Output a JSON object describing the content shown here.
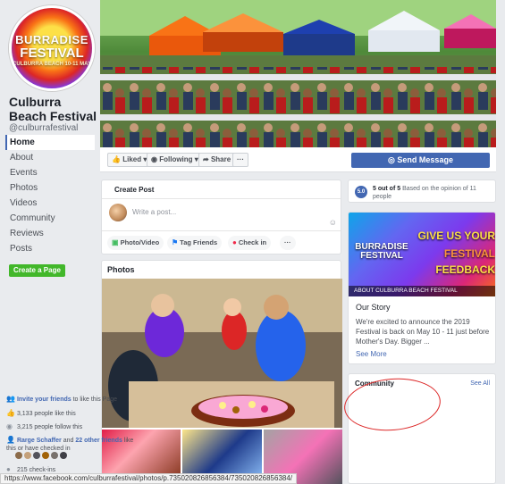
{
  "page": {
    "name": "Culburra Beach Festival",
    "handle": "@culburrafestival",
    "logo": {
      "line1": "BURRADISE",
      "line2": "FESTIVAL",
      "line3": "CULBURRA BEACH 10-11 MAY"
    }
  },
  "nav": {
    "items": [
      {
        "label": "Home",
        "active": true
      },
      {
        "label": "About"
      },
      {
        "label": "Events"
      },
      {
        "label": "Photos"
      },
      {
        "label": "Videos"
      },
      {
        "label": "Community"
      },
      {
        "label": "Reviews"
      },
      {
        "label": "Posts"
      }
    ],
    "create_page": "Create a Page"
  },
  "action_bar": {
    "liked": "Liked",
    "following": "Following",
    "share": "Share",
    "more": "···",
    "send_message": "Send Message"
  },
  "create_post": {
    "title": "Create Post",
    "placeholder": "Write a post...",
    "photo_video": "Photo/Video",
    "tag_friends": "Tag Friends",
    "check_in": "Check in",
    "more": "···"
  },
  "photos": {
    "title": "Photos"
  },
  "rating": {
    "score": "5.0",
    "summary": "5 out of 5",
    "detail": "Based on the opinion of 11 people"
  },
  "story": {
    "banner_logo": "BURRADISE FESTIVAL",
    "banner_line1": "GIVE US YOUR",
    "banner_line2": "FESTIVAL",
    "banner_line3": "FEEDBACK",
    "banner_caption": "ABOUT CULBURRA BEACH FESTIVAL",
    "title": "Our Story",
    "body": "We're excited to announce the 2019 Festival is back on May 10 - 11 just before Mother's Day. Bigger ...",
    "see_more": "See More"
  },
  "community": {
    "title": "Community",
    "see_all": "See All",
    "invite_link": "Invite your friends",
    "invite_rest": "to like this Page",
    "likes": "3,133 people like this",
    "follows": "3,215 people follow this",
    "friends_name": "Rarge Schaffer",
    "friends_mid": "and",
    "friends_link": "22 other friends",
    "friends_rest": "like this or have checked in",
    "checkins": "215 check-ins"
  },
  "status_bar": {
    "url": "https://www.facebook.com/culburrafestival/photos/p.735020826856384/735020826856384/"
  },
  "colors": {
    "fb_blue": "#4267b2",
    "green": "#42b72a",
    "annotation_red": "#dc2626"
  }
}
